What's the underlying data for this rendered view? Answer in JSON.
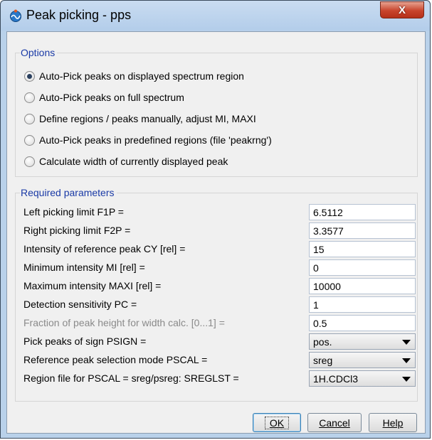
{
  "window": {
    "title": "Peak picking - pps",
    "close_label": "X",
    "colors": {
      "legend": "#1a3aa6",
      "close": "#c8442c",
      "titlebar": "#b9d1ea"
    }
  },
  "options": {
    "legend": "Options",
    "items": [
      {
        "label": "Auto-Pick peaks on displayed spectrum region",
        "checked": true
      },
      {
        "label": "Auto-Pick peaks on full spectrum",
        "checked": false
      },
      {
        "label": "Define regions / peaks manually, adjust MI, MAXI",
        "checked": false
      },
      {
        "label": "Auto-Pick peaks in predefined regions (file 'peakrng')",
        "checked": false
      },
      {
        "label": "Calculate width of currently displayed peak",
        "checked": false
      }
    ]
  },
  "params": {
    "legend": "Required parameters",
    "rows": [
      {
        "label": "Left picking limit F1P =",
        "value": "6.5112"
      },
      {
        "label": "Right picking limit F2P =",
        "value": "3.3577"
      },
      {
        "label": "Intensity of reference peak CY [rel] =",
        "value": "15"
      },
      {
        "label": "Minimum intensity MI [rel] =",
        "value": "0"
      },
      {
        "label": "Maximum intensity MAXI [rel] =",
        "value": "10000"
      },
      {
        "label": "Detection sensitivity PC =",
        "value": "1"
      },
      {
        "label": "Fraction of peak height for width calc. [0...1] =",
        "value": "0.5"
      },
      {
        "label": "Pick peaks of sign PSIGN =",
        "value": "pos."
      },
      {
        "label": "Reference peak selection mode PSCAL =",
        "value": "sreg"
      },
      {
        "label": "Region file for PSCAL = sreg/psreg: SREGLST =",
        "value": "1H.CDCl3"
      }
    ]
  },
  "buttons": {
    "ok": "OK",
    "cancel": "Cancel",
    "help": "Help"
  }
}
